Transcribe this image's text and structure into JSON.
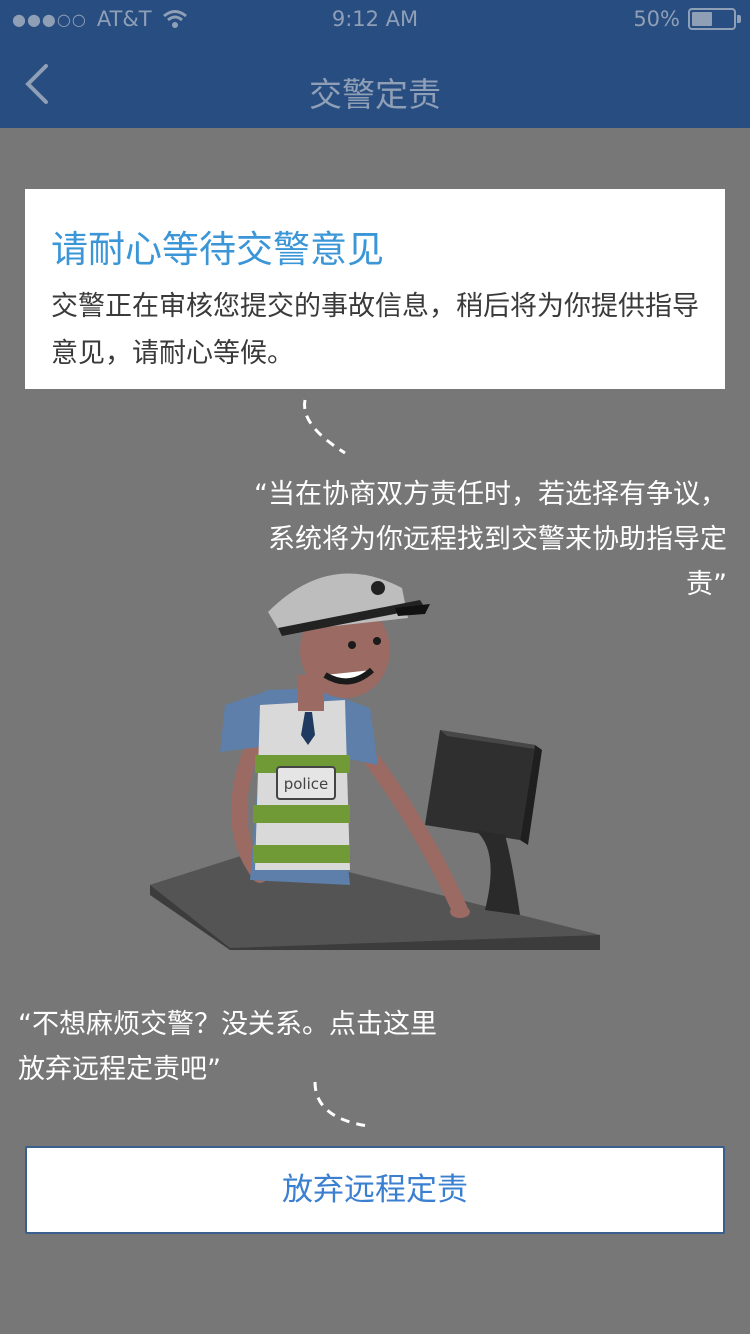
{
  "status_bar": {
    "signal": "●●●○○",
    "carrier": "AT&T",
    "time": "9:12 AM",
    "battery_percent": "50%",
    "battery_level": 0.5
  },
  "nav": {
    "title": "交警定责"
  },
  "card": {
    "title": "请耐心等待交警意见",
    "body": "交警正在审核您提交的事故信息，稍后将为你提供指导意见，请耐心等候。"
  },
  "quote_dispute": "“当在协商双方责任时，若选择有争议，系统将为你远程找到交警来协助指导定责”",
  "illustration": {
    "badge_text": "police"
  },
  "quote_skip": "“不想麻烦交警？没关系。点击这里放弃远程定责吧”",
  "actions": {
    "abandon_label": "放弃远程定责"
  },
  "colors": {
    "header": "#284d80",
    "accent": "#3b96d8",
    "overlay": "#777777"
  },
  "icons": [
    "wifi-icon",
    "battery-icon",
    "back-chevron-icon"
  ]
}
